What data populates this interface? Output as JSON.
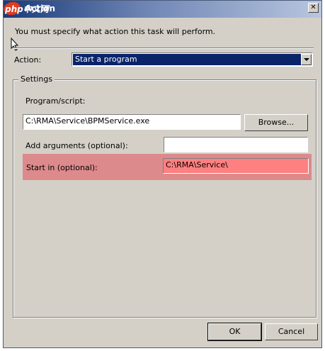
{
  "window": {
    "title": "Action",
    "close_symbol": "✕",
    "watermark": "php中文网"
  },
  "intro_text": "You must specify what action this task will perform.",
  "action": {
    "label": "Action:",
    "selected": "Start a program"
  },
  "settings": {
    "group_label": "Settings",
    "program_label": "Program/script:",
    "program_value": "C:\\RMA\\Service\\BPMService.exe",
    "browse_label": "Browse...",
    "args_label": "Add arguments (optional):",
    "args_value": "",
    "startin_label": "Start in (optional):",
    "startin_value": "C:\\RMA\\Service\\"
  },
  "buttons": {
    "ok": "OK",
    "cancel": "Cancel"
  },
  "colors": {
    "highlight": "#dd8a8c",
    "selection": "#0a246a",
    "dialog_bg": "#d4d0c8"
  },
  "icons": [
    "close-icon",
    "chevron-down-icon",
    "mouse-cursor-icon"
  ]
}
